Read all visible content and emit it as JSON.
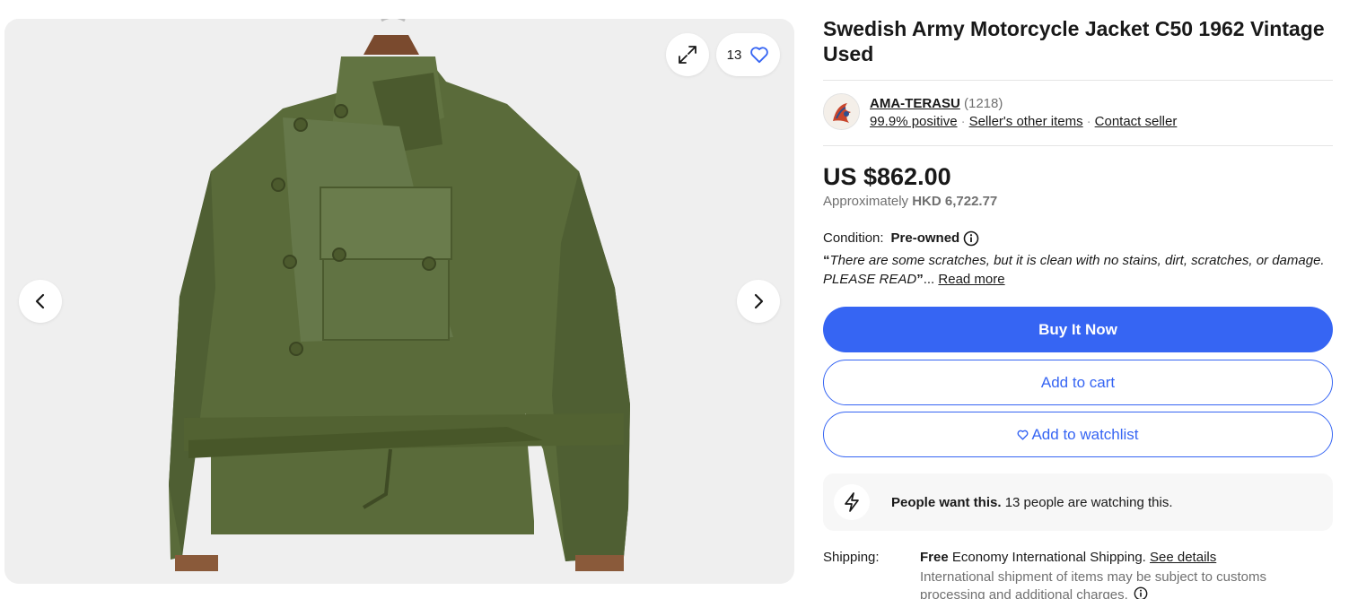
{
  "gallery": {
    "watch_count": "13",
    "colors": {
      "jacket": "#5a6b3a",
      "hanger": "#7a4a2e",
      "background": "#efefef"
    }
  },
  "listing": {
    "title": "Swedish Army Motorcycle Jacket C50 1962 Vintage Used"
  },
  "seller": {
    "name": "AMA-TERASU",
    "feedback_count": "(1218)",
    "positive": "99.9% positive",
    "other_items": "Seller's other items",
    "contact": "Contact seller"
  },
  "price": {
    "main": "US $862.00",
    "approx_prefix": "Approximately",
    "approx_value": "HKD 6,722.77"
  },
  "condition": {
    "label": "Condition:",
    "value": "Pre-owned",
    "open_quote": "“",
    "description": "There are some scratches, but it is clean with no stains, dirt, scratches, or damage. PLEASE READ",
    "close_quote": "”",
    "ellipsis": "...",
    "read_more": "Read more"
  },
  "actions": {
    "buy_now": "Buy It Now",
    "add_to_cart": "Add to cart",
    "add_to_watchlist": "Add to watchlist"
  },
  "signal": {
    "bold": "People want this.",
    "text": "13 people are watching this."
  },
  "shipping": {
    "label": "Shipping:",
    "free": "Free",
    "service": "Economy International Shipping.",
    "details_link": "See details",
    "note": "International shipment of items may be subject to customs processing and additional charges."
  },
  "theme": {
    "accent": "#3665f3",
    "text": "#191919",
    "muted": "#707070"
  }
}
